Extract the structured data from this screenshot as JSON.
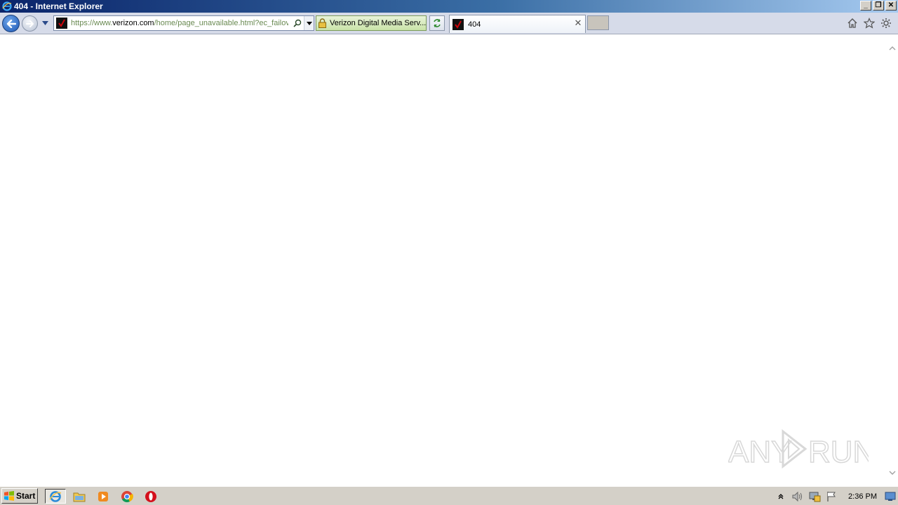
{
  "window": {
    "title": "404 - Internet Explorer"
  },
  "address_bar": {
    "url_prefix": "https://www.",
    "url_host": "verizon.com",
    "url_rest": "/home/page_unavailable.html?ec_failov"
  },
  "security": {
    "label": "Verizon Digital Media Serv..."
  },
  "tabs": [
    {
      "label": "404"
    }
  ],
  "watermark": {
    "text": "ANY RUN"
  },
  "taskbar": {
    "start_label": "Start",
    "clock": "2:36 PM"
  },
  "colors": {
    "title_gradient_start": "#0a246a",
    "title_gradient_end": "#a6caf0",
    "security_green": "#c9e3a8",
    "verizon_red": "#cd040b"
  },
  "icons": [
    "ie-icon",
    "back-arrow-icon",
    "forward-arrow-icon",
    "verizon-check-icon",
    "search-icon",
    "lock-icon",
    "refresh-icon",
    "home-icon",
    "star-icon",
    "gear-icon",
    "explorer-folder-icon",
    "media-player-icon",
    "chrome-icon",
    "opera-icon",
    "chevron-up-icon",
    "speaker-icon",
    "network-icon",
    "flag-icon",
    "show-desktop-icon"
  ]
}
